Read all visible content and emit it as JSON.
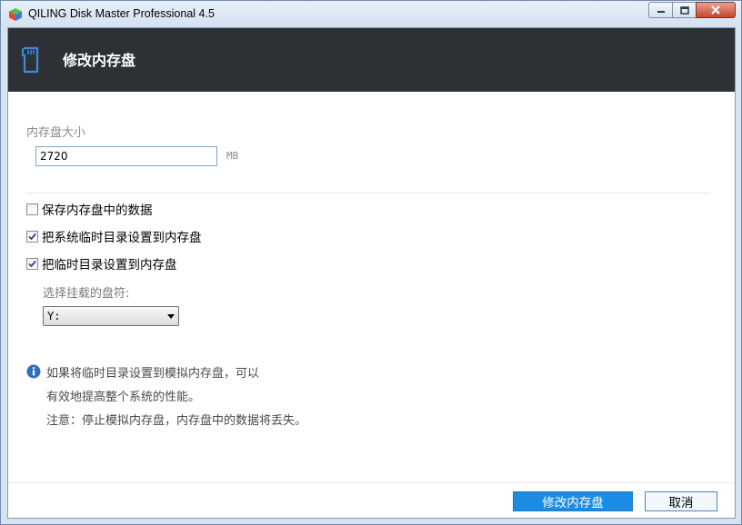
{
  "window": {
    "title": "QILING Disk Master Professional 4.5"
  },
  "header": {
    "title": "修改内存盘"
  },
  "size": {
    "label": "内存盘大小",
    "value": "2720",
    "unit": "MB"
  },
  "options": {
    "keep_data": {
      "label": "保存内存盘中的数据",
      "checked": false
    },
    "system_temp": {
      "label": "把系统临时目录设置到内存盘",
      "checked": true
    },
    "temp": {
      "label": "把临时目录设置到内存盘",
      "checked": true
    }
  },
  "drive": {
    "label": "选择挂载的盘符:",
    "selected": "Y:"
  },
  "info": {
    "line1": "如果将临时目录设置到模拟内存盘，可以",
    "line2": "有效地提高整个系统的性能。",
    "line3": "注意：停止模拟内存盘，内存盘中的数据将丢失。"
  },
  "buttons": {
    "modify": "修改内存盘",
    "cancel": "取消"
  },
  "colors": {
    "header_bg": "#2d3136",
    "primary": "#1c8be4"
  }
}
